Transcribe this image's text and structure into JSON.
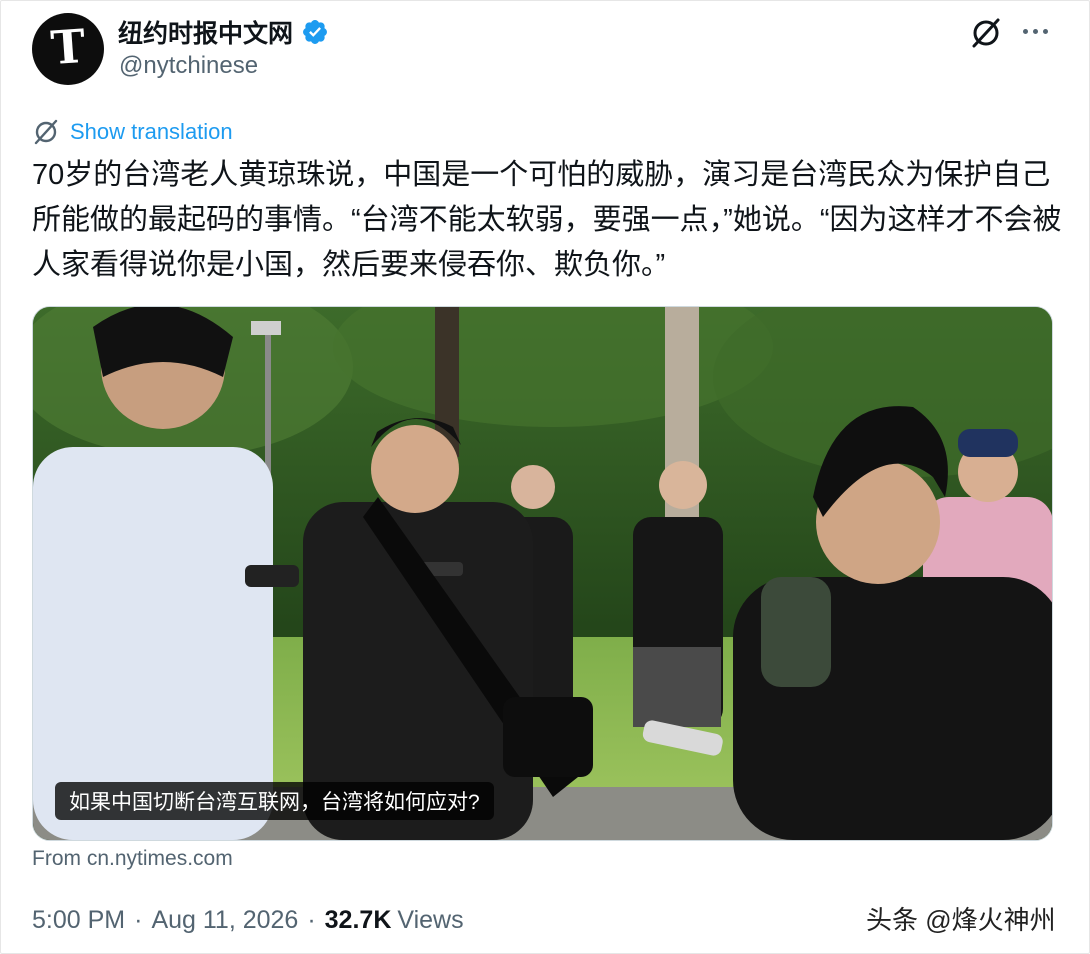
{
  "account": {
    "display_name": "纽约时报中文网",
    "handle": "@nytchinese",
    "avatar_glyph": "T",
    "verified_color": "#1d9bf0"
  },
  "actions": {
    "grok_icon": "grok-icon",
    "more_icon": "more-icon"
  },
  "translation": {
    "label": "Show translation",
    "icon": "translate-icon"
  },
  "tweet": {
    "text": "70岁的台湾老人黄琼珠说，中国是一个可怕的威胁，演习是台湾民众为保护自己所能做的最起码的事情。“台湾不能太软弱，要强一点，”她说。“因为这样才不会被人家看得说你是小国，然后要来侵吞你、欺负你。”"
  },
  "card": {
    "title": "如果中国切断台湾互联网，台湾将如何应对?",
    "source": "From cn.nytimes.com"
  },
  "meta": {
    "time": "5:00 PM",
    "date": "Aug 11, 2026",
    "views_count": "32.7K",
    "views_label": "Views"
  },
  "watermark": "头条 @烽火神州",
  "colors": {
    "link": "#1d9bf0",
    "secondary_text": "#536471",
    "primary_text": "#0f1419"
  }
}
